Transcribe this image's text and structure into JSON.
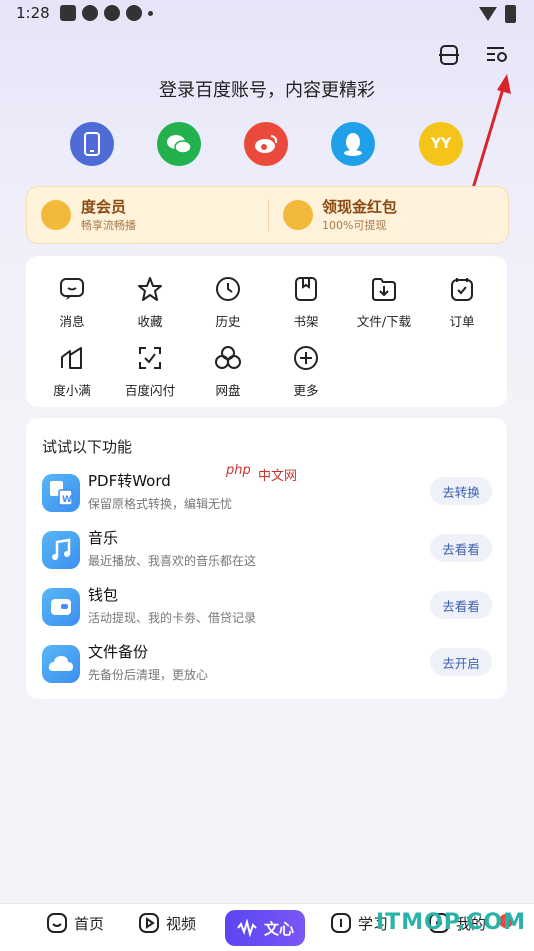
{
  "status_bar": {
    "time": "1:28"
  },
  "header": {
    "login_prompt": "登录百度账号，内容更精彩"
  },
  "social_logins": [
    {
      "name": "phone",
      "color": "#4f6bd8"
    },
    {
      "name": "wechat",
      "color": "#22b14c"
    },
    {
      "name": "weibo",
      "color": "#e94a3b"
    },
    {
      "name": "qq",
      "color": "#1fa0e8"
    },
    {
      "name": "yy",
      "color": "#f4c419",
      "label": "YY"
    }
  ],
  "vip_card": {
    "left": {
      "title": "度会员",
      "subtitle": "畅享流畅播"
    },
    "right": {
      "title": "领现金红包",
      "subtitle": "100%可提现"
    }
  },
  "grid": [
    {
      "label": "消息",
      "icon": "message-icon"
    },
    {
      "label": "收藏",
      "icon": "star-icon"
    },
    {
      "label": "历史",
      "icon": "clock-icon"
    },
    {
      "label": "书架",
      "icon": "bookmark-icon"
    },
    {
      "label": "文件/下载",
      "icon": "folder-download-icon"
    },
    {
      "label": "订单",
      "icon": "order-icon"
    },
    {
      "label": "度小满",
      "icon": "duxiaoman-icon"
    },
    {
      "label": "百度闪付",
      "icon": "scan-pay-icon"
    },
    {
      "label": "网盘",
      "icon": "cloud-disk-icon"
    },
    {
      "label": "更多",
      "icon": "plus-circle-icon"
    }
  ],
  "try_section": {
    "title": "试试以下功能",
    "items": [
      {
        "name": "PDF转Word",
        "desc": "保留原格式转换，编辑无忧",
        "button": "去转换",
        "icon": "pdf-word-icon"
      },
      {
        "name": "音乐",
        "desc": "最近播放、我喜欢的音乐都在这",
        "button": "去看看",
        "icon": "music-icon"
      },
      {
        "name": "钱包",
        "desc": "活动提现、我的卡劵、借贷记录",
        "button": "去看看",
        "icon": "wallet-icon"
      },
      {
        "name": "文件备份",
        "desc": "先备份后清理，更放心",
        "button": "去开启",
        "icon": "cloud-backup-icon"
      }
    ]
  },
  "watermarks": {
    "php": "php",
    "cn": "中文网",
    "itmop": "ITMOP.COM"
  },
  "bottom_nav": {
    "home": "首页",
    "video": "视频",
    "wenxin": "文心",
    "study": "学习",
    "mine": "我的"
  },
  "colors": {
    "accent": "#5a47f2",
    "arrow": "#d9242b"
  }
}
